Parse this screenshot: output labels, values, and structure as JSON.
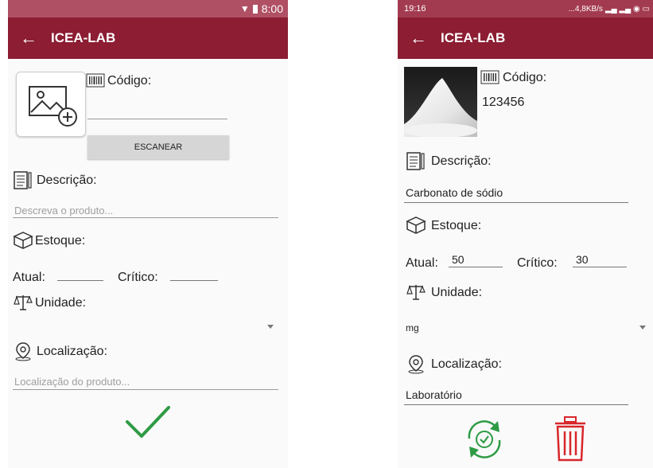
{
  "left": {
    "status": {
      "time": "8:00"
    },
    "appbar": {
      "title": "ICEA-LAB"
    },
    "codigo_label": "Código:",
    "scan_button": "ESCANEAR",
    "descricao_label": "Descrição:",
    "descricao_placeholder": "Descreva o produto...",
    "estoque_label": "Estoque:",
    "atual_label": "Atual:",
    "critico_label": "Crítico:",
    "unidade_label": "Unidade:",
    "localizacao_label": "Localização:",
    "localizacao_placeholder": "Localização do produto..."
  },
  "right": {
    "status": {
      "time": "19:16",
      "indicators": "...4,8KB/s"
    },
    "appbar": {
      "title": "ICEA-LAB"
    },
    "codigo_label": "Código:",
    "codigo_value": "123456",
    "descricao_label": "Descrição:",
    "descricao_value": "Carbonato de sódio",
    "estoque_label": "Estoque:",
    "atual_label": "Atual:",
    "atual_value": "50",
    "critico_label": "Crítico:",
    "critico_value": "30",
    "unidade_label": "Unidade:",
    "unidade_value": "mg",
    "localizacao_label": "Localização:",
    "localizacao_value": "Laboratório"
  },
  "colors": {
    "appbar": "#8c1d32",
    "confirm": "#2e9b44",
    "delete": "#d8262a",
    "sync": "#2e9b44"
  }
}
